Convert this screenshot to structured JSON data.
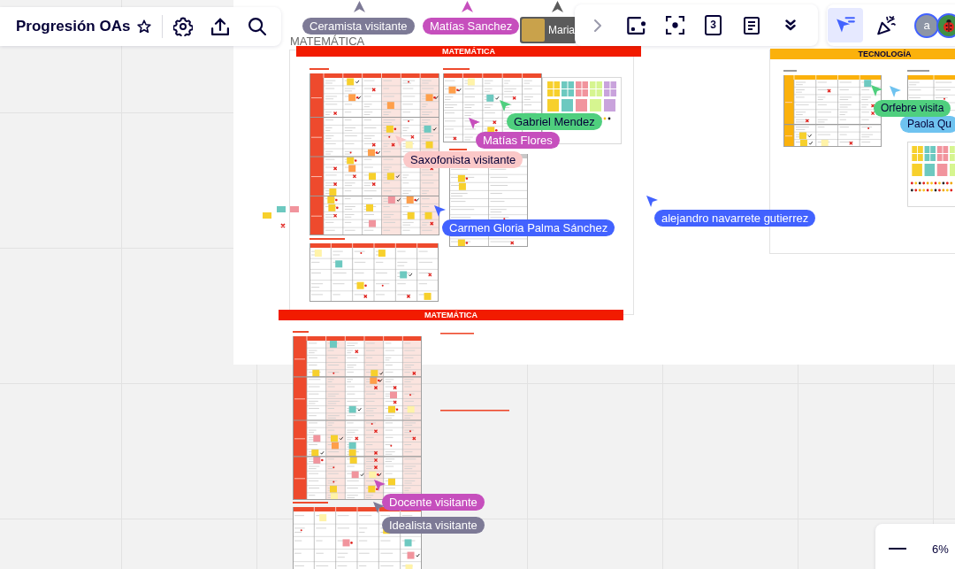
{
  "board_menu": {
    "title": "Progresión OAs",
    "starred": false,
    "tools": [
      {
        "kind": "settings"
      },
      {
        "kind": "share"
      },
      {
        "kind": "search"
      }
    ]
  },
  "toolbar": {
    "items": [
      {
        "kind": "expand"
      },
      {
        "kind": "frame"
      },
      {
        "kind": "focus"
      },
      {
        "kind": "countdown",
        "label": "3"
      },
      {
        "kind": "notes"
      },
      {
        "kind": "more"
      }
    ]
  },
  "collaboration": {
    "tools": [
      {
        "kind": "cursors",
        "selected": true
      },
      {
        "kind": "celebrate",
        "selected": false
      }
    ],
    "avatars": [
      {
        "kind": "initial",
        "label": "a"
      },
      {
        "kind": "picture"
      }
    ]
  },
  "canvas": {
    "frames": [
      {
        "title": "MATEMÁTICA",
        "banner": "MATEMÁTICA",
        "color": "#f21b00"
      },
      {
        "banner": "MATEMÁTICA",
        "color": "#f21b00"
      },
      {
        "banner": "TECNOLOGÍA",
        "color": "#fbb10c"
      }
    ],
    "cursors": [
      {
        "kind": "label",
        "name": "Ceramista visitante",
        "color": "#7d7a96"
      },
      {
        "kind": "label",
        "name": "Matías Sanchez",
        "color": "#c64fbd"
      },
      {
        "kind": "photo",
        "name": "Maria",
        "color": "#5b5b5b"
      },
      {
        "kind": "label",
        "name": "Gabriel Mendez",
        "color": "#4fcf7e"
      },
      {
        "kind": "label",
        "name": "Matías Flores",
        "color": "#c64fbd"
      },
      {
        "kind": "label",
        "name": "Saxofonista visitante",
        "color": "#fbc8c8"
      },
      {
        "kind": "label",
        "name": "Carmen Gloria Palma Sánchez",
        "color": "#4262ff"
      },
      {
        "kind": "label",
        "name": "alejandro navarrete gutierrez",
        "color": "#4262ff"
      },
      {
        "kind": "label",
        "name": "Orfebre visita",
        "color": "#4fcf7e"
      },
      {
        "kind": "label",
        "name": "Paola Qu",
        "color": "#6fc3f0"
      },
      {
        "kind": "label",
        "name": "Docente visitante",
        "color": "#c64fbd"
      },
      {
        "kind": "label",
        "name": "Idealista visitante",
        "color": "#7d7a96"
      }
    ]
  },
  "zoom": {
    "value": "6%"
  }
}
